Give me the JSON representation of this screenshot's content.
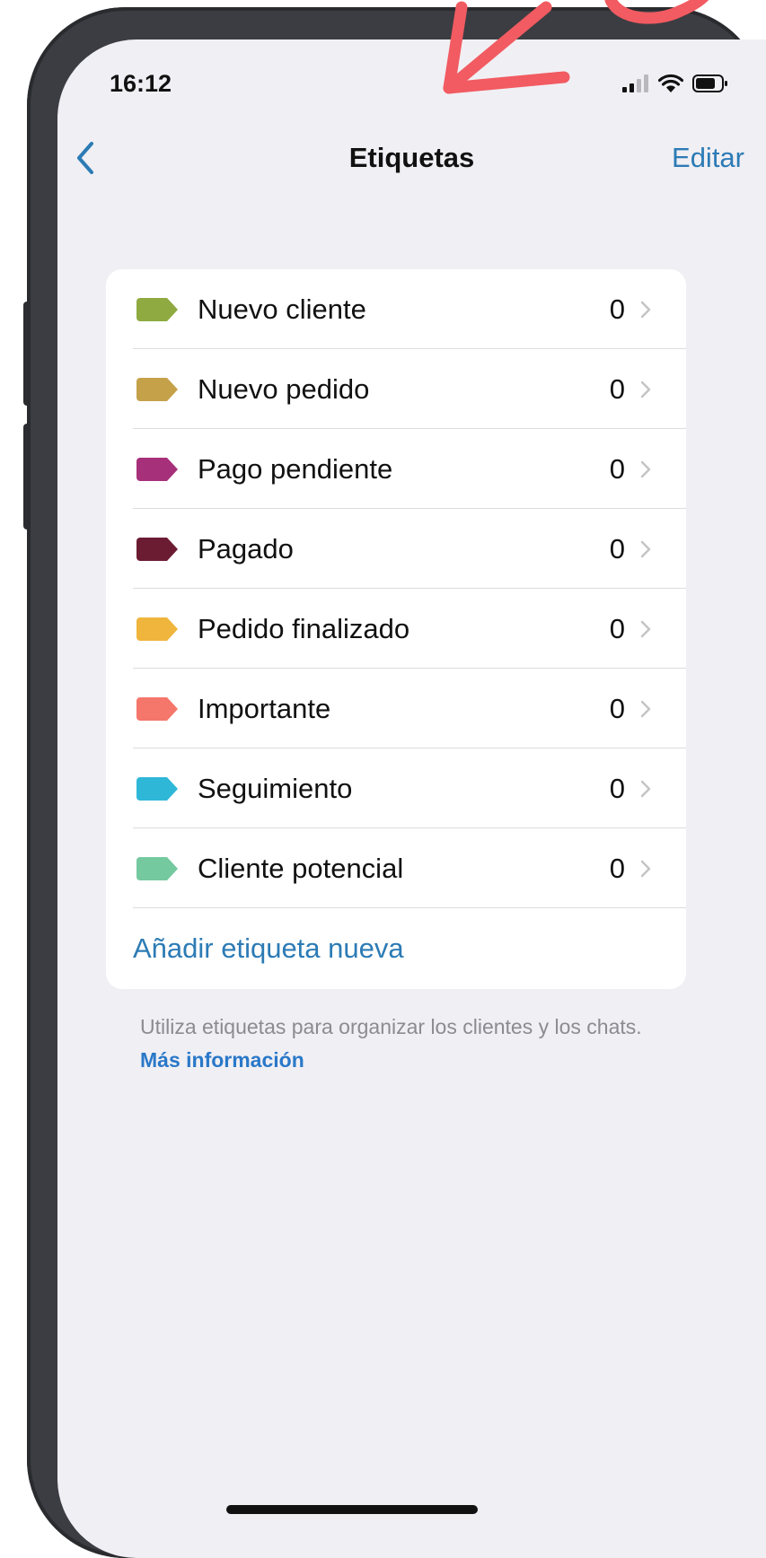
{
  "status_bar": {
    "time": "16:12"
  },
  "nav": {
    "title": "Etiquetas",
    "edit_label": "Editar"
  },
  "labels": [
    {
      "name": "Nuevo cliente",
      "count": "0",
      "color": "#8eaa40"
    },
    {
      "name": "Nuevo pedido",
      "count": "0",
      "color": "#c5a14a"
    },
    {
      "name": "Pago pendiente",
      "count": "0",
      "color": "#a7307a"
    },
    {
      "name": "Pagado",
      "count": "0",
      "color": "#6b1c33"
    },
    {
      "name": "Pedido finalizado",
      "count": "0",
      "color": "#efb53c"
    },
    {
      "name": "Importante",
      "count": "0",
      "color": "#f5766a"
    },
    {
      "name": "Seguimiento",
      "count": "0",
      "color": "#2fb7d8"
    },
    {
      "name": "Cliente potencial",
      "count": "0",
      "color": "#74c99f"
    }
  ],
  "add_label_text": "Añadir etiqueta nueva",
  "footer": {
    "text": "Utiliza etiquetas para organizar los clientes y los chats.",
    "link": "Más información"
  },
  "colors": {
    "accent_blue": "#2c7bb5",
    "annotation_red": "#f15b61",
    "background": "#f0eff4"
  }
}
